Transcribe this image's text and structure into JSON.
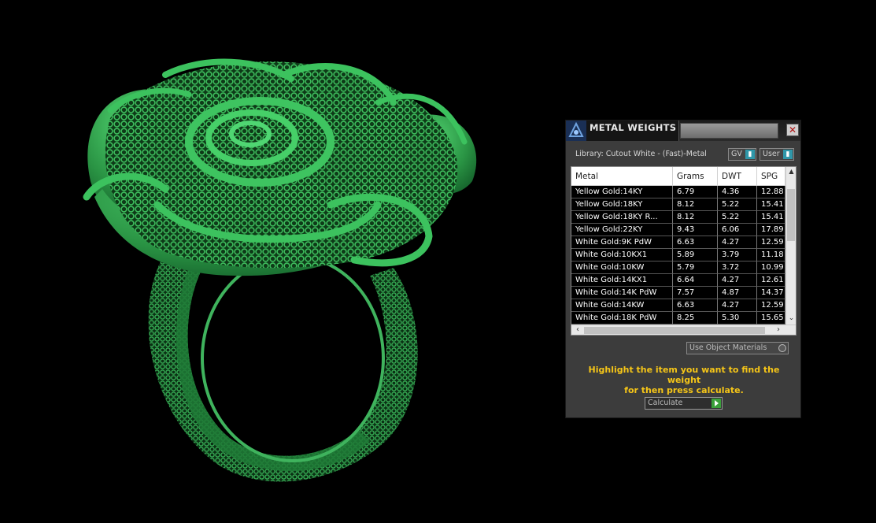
{
  "dialog": {
    "title": "METAL WEIGHTS",
    "close_icon": "close-icon",
    "library_label": "Library: Cutout White - (Fast)-Metal",
    "toggles": {
      "gv": "GV",
      "user": "User"
    },
    "table": {
      "columns": [
        "Metal",
        "Grams",
        "DWT",
        "SPG"
      ],
      "rows": [
        [
          "Yellow Gold:14KY",
          "6.79",
          "4.36",
          "12.88"
        ],
        [
          "Yellow Gold:18KY",
          "8.12",
          "5.22",
          "15.41"
        ],
        [
          "Yellow Gold:18KY R...",
          "8.12",
          "5.22",
          "15.41"
        ],
        [
          "Yellow Gold:22KY",
          "9.43",
          "6.06",
          "17.89"
        ],
        [
          "White Gold:9K PdW",
          "6.63",
          "4.27",
          "12.59"
        ],
        [
          "White Gold:10KX1",
          "5.89",
          "3.79",
          "11.18"
        ],
        [
          "White Gold:10KW",
          "5.79",
          "3.72",
          "10.99"
        ],
        [
          "White Gold:14KX1",
          "6.64",
          "4.27",
          "12.61"
        ],
        [
          "White Gold:14K PdW",
          "7.57",
          "4.87",
          "14.37"
        ],
        [
          "White Gold:14KW",
          "6.63",
          "4.27",
          "12.59"
        ],
        [
          "White Gold:18K PdW",
          "8.25",
          "5.30",
          "15.65"
        ]
      ]
    },
    "use_object_materials": "Use Object Materials",
    "instruction_line1": "Highlight the item you want to find the weight",
    "instruction_line2": "for then press calculate.",
    "calculate_label": "Calculate"
  },
  "colors": {
    "ring": "#2e9a48",
    "instruction": "#f5c518",
    "toggle_knob": "#2f97a9",
    "calc_play": "#3aa03a"
  }
}
